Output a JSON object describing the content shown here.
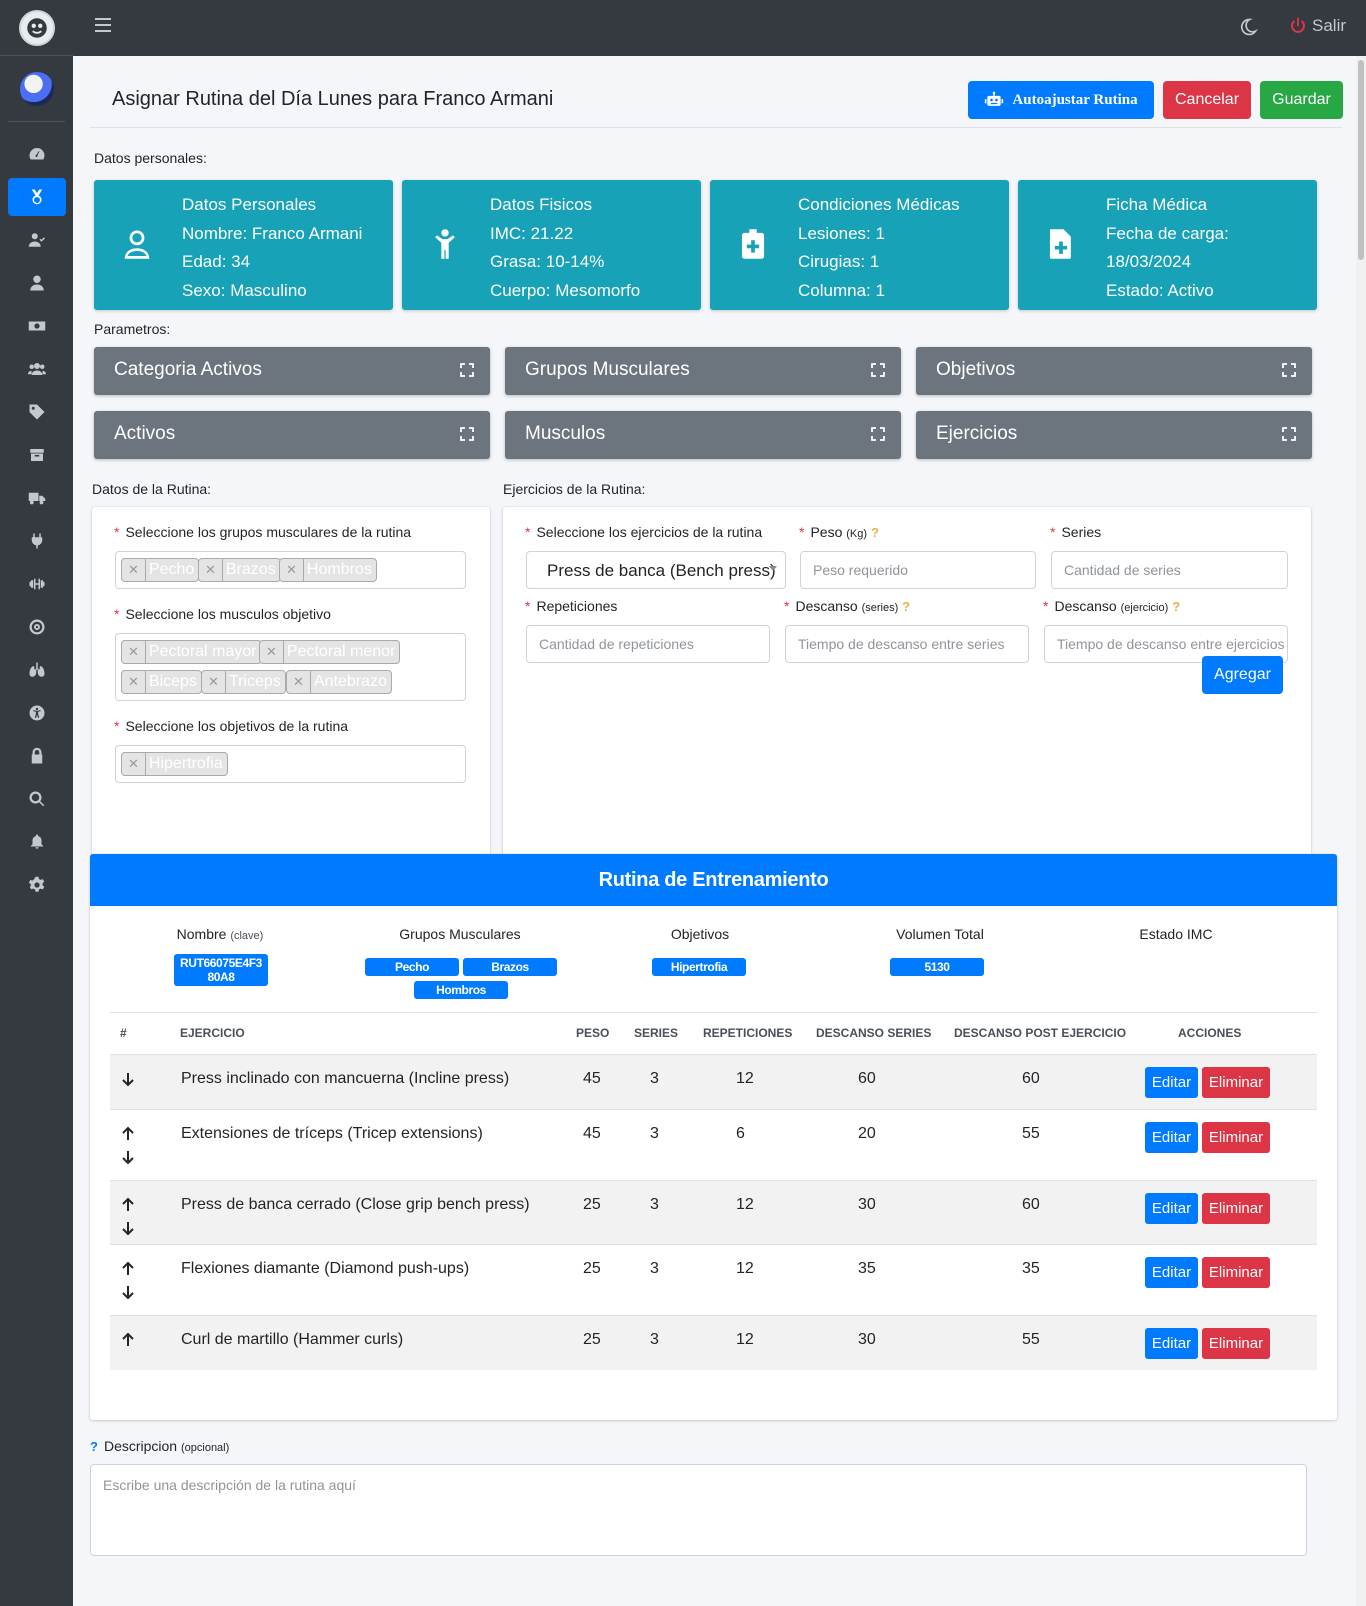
{
  "topbar": {
    "logout_label": "Salir"
  },
  "header": {
    "title": "Asignar Rutina del Día Lunes para Franco Armani",
    "auto_label": "Autoajustar Rutina",
    "cancel_label": "Cancelar",
    "save_label": "Guardar"
  },
  "sections": {
    "personal": "Datos personales:",
    "params": "Parametros:",
    "routine_data": "Datos de la Rutina:",
    "routine_exercises": "Ejercicios de la Rutina:"
  },
  "info_boxes": [
    {
      "icon": "user-icon",
      "lines": [
        "Datos Personales",
        "Nombre: Franco Armani",
        "Edad: 34",
        "Sexo: Masculino"
      ]
    },
    {
      "icon": "child-icon",
      "lines": [
        "Datos Fisicos",
        "IMC: 21.22",
        "Grasa: 10-14%",
        "Cuerpo: Mesomorfo"
      ]
    },
    {
      "icon": "clipboard-plus-icon",
      "lines": [
        "Condiciones Médicas",
        "Lesiones: 1",
        "Cirugias: 1",
        "Columna: 1"
      ]
    },
    {
      "icon": "file-medical-icon",
      "lines": [
        "Ficha Médica",
        "Fecha de carga:",
        "18/03/2024",
        "Estado: Activo"
      ]
    }
  ],
  "params": [
    "Categoria Activos",
    "Grupos Musculares",
    "Objetivos",
    "Activos",
    "Musculos",
    "Ejercicios"
  ],
  "routine_form": {
    "groups_label": "Seleccione los grupos musculares de la rutina",
    "groups": [
      "Pecho",
      "Brazos",
      "Hombros"
    ],
    "muscles_label": "Seleccione los musculos objetivo",
    "muscles": [
      "Pectoral mayor",
      "Pectoral menor",
      "Biceps",
      "Triceps",
      "Antebrazo"
    ],
    "goals_label": "Seleccione los objetivos de la rutina",
    "goals": [
      "Hipertrofia"
    ]
  },
  "exercise_form": {
    "exercise_label": "Seleccione los ejercicios de la rutina",
    "exercise_value": "Press de banca (Bench press)",
    "weight_label": "Peso",
    "weight_unit": "(Kg)",
    "weight_placeholder": "Peso requerido",
    "series_label": "Series",
    "series_placeholder": "Cantidad de series",
    "reps_label": "Repeticiones",
    "reps_placeholder": "Cantidad de repeticiones",
    "rest_series_label": "Descanso",
    "rest_series_unit": "(series)",
    "rest_series_placeholder": "Tiempo de descanso entre series",
    "rest_ex_label": "Descanso",
    "rest_ex_unit": "(ejercicio)",
    "rest_ex_placeholder": "Tiempo de descanso entre ejercicios",
    "add_label": "Agregar"
  },
  "routine": {
    "title": "Rutina de Entrenamiento",
    "summary": {
      "name_label": "Nombre",
      "name_hint": "(clave)",
      "name_value": [
        "RUT66075E4F3",
        "80A8"
      ],
      "groups_label": "Grupos Musculares",
      "groups": [
        "Pecho",
        "Brazos",
        "Hombros"
      ],
      "goals_label": "Objetivos",
      "goals": [
        "Hipertrofia"
      ],
      "volume_label": "Volumen Total",
      "volume_value": "5130",
      "imc_label": "Estado IMC"
    },
    "columns": [
      "#",
      "Ejercicio",
      "Peso",
      "Series",
      "Repeticiones",
      "Descanso series",
      "Descanso post ejercicio",
      "Acciones"
    ],
    "edit_label": "Editar",
    "delete_label": "Eliminar",
    "rows": [
      {
        "name": "Press inclinado con mancuerna (Incline press)",
        "peso": "45",
        "series": "3",
        "reps": "12",
        "desc_series": "60",
        "desc_post": "60",
        "up": false,
        "down": true
      },
      {
        "name": "Extensiones de tríceps (Tricep extensions)",
        "peso": "45",
        "series": "3",
        "reps": "6",
        "desc_series": "20",
        "desc_post": "55",
        "up": true,
        "down": true
      },
      {
        "name": "Press de banca cerrado (Close grip bench press)",
        "peso": "25",
        "series": "3",
        "reps": "12",
        "desc_series": "30",
        "desc_post": "60",
        "up": true,
        "down": true
      },
      {
        "name": "Flexiones diamante (Diamond push-ups)",
        "peso": "25",
        "series": "3",
        "reps": "12",
        "desc_series": "35",
        "desc_post": "35",
        "up": true,
        "down": true
      },
      {
        "name": "Curl de martillo (Hammer curls)",
        "peso": "25",
        "series": "3",
        "reps": "12",
        "desc_series": "30",
        "desc_post": "55",
        "up": true,
        "down": false
      }
    ]
  },
  "description": {
    "label": "Descripcion",
    "hint": "(opcional)",
    "placeholder": "Escribe una descripción de la rutina aquí"
  },
  "colors": {
    "primary": "#007bff",
    "info": "#17a2b8",
    "danger": "#dc3545",
    "success": "#28a745",
    "secondary": "#6c757d",
    "sidebar": "#343a40"
  }
}
